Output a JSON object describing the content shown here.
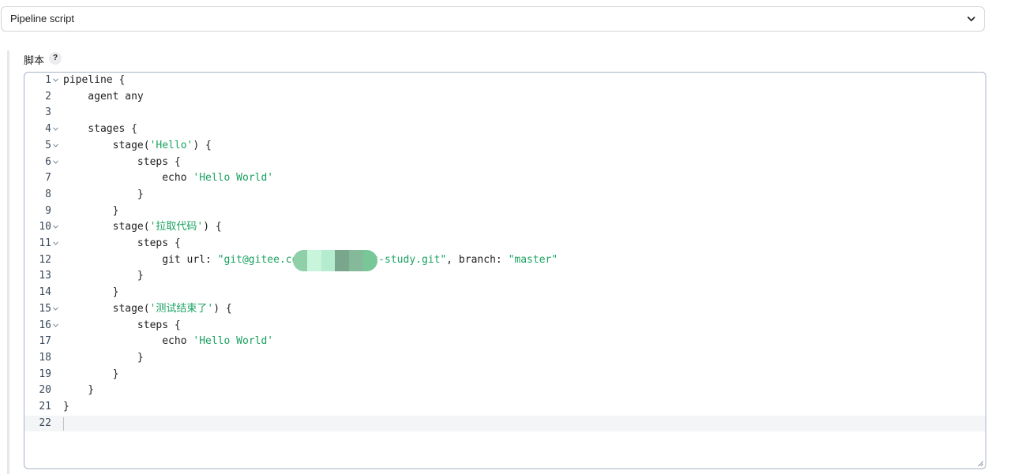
{
  "definition_select": {
    "value": "Pipeline script",
    "icon": "chevron-down-icon"
  },
  "script_field": {
    "label": "脚本",
    "help": "?"
  },
  "editor": {
    "colors": {
      "string": "#1aa260",
      "gutter": "#3b4a5c",
      "border": "#a6b4c8"
    },
    "lines": [
      {
        "num": "1",
        "fold": true,
        "parts": [
          {
            "t": "pipeline {",
            "s": false
          }
        ]
      },
      {
        "num": "2",
        "fold": false,
        "parts": [
          {
            "t": "    agent any",
            "s": false
          }
        ]
      },
      {
        "num": "3",
        "fold": false,
        "parts": [
          {
            "t": "",
            "s": false
          }
        ]
      },
      {
        "num": "4",
        "fold": true,
        "parts": [
          {
            "t": "    stages {",
            "s": false
          }
        ]
      },
      {
        "num": "5",
        "fold": true,
        "parts": [
          {
            "t": "        stage(",
            "s": false
          },
          {
            "t": "'Hello'",
            "s": true
          },
          {
            "t": ") {",
            "s": false
          }
        ]
      },
      {
        "num": "6",
        "fold": true,
        "parts": [
          {
            "t": "            steps {",
            "s": false
          }
        ]
      },
      {
        "num": "7",
        "fold": false,
        "parts": [
          {
            "t": "                echo ",
            "s": false
          },
          {
            "t": "'Hello World'",
            "s": true
          }
        ]
      },
      {
        "num": "8",
        "fold": false,
        "parts": [
          {
            "t": "            }",
            "s": false
          }
        ]
      },
      {
        "num": "9",
        "fold": false,
        "parts": [
          {
            "t": "        }",
            "s": false
          }
        ]
      },
      {
        "num": "10",
        "fold": true,
        "parts": [
          {
            "t": "        stage(",
            "s": false
          },
          {
            "t": "'拉取代码'",
            "s": true
          },
          {
            "t": ") {",
            "s": false
          }
        ]
      },
      {
        "num": "11",
        "fold": true,
        "parts": [
          {
            "t": "            steps {",
            "s": false
          }
        ]
      },
      {
        "num": "12",
        "fold": false,
        "parts": [
          {
            "t": "                git url: ",
            "s": false
          },
          {
            "t": "\"git@gitee.com",
            "s": true
          },
          {
            "t": "        ",
            "s": false
          },
          {
            "t": "/git-study.git\"",
            "s": true
          },
          {
            "t": ", branch: ",
            "s": false
          },
          {
            "t": "\"master\"",
            "s": true
          }
        ]
      },
      {
        "num": "13",
        "fold": false,
        "parts": [
          {
            "t": "            }",
            "s": false
          }
        ]
      },
      {
        "num": "14",
        "fold": false,
        "parts": [
          {
            "t": "        }",
            "s": false
          }
        ]
      },
      {
        "num": "15",
        "fold": true,
        "parts": [
          {
            "t": "        stage(",
            "s": false
          },
          {
            "t": "'测试结束了'",
            "s": true
          },
          {
            "t": ") {",
            "s": false
          }
        ]
      },
      {
        "num": "16",
        "fold": true,
        "parts": [
          {
            "t": "            steps {",
            "s": false
          }
        ]
      },
      {
        "num": "17",
        "fold": false,
        "parts": [
          {
            "t": "                echo ",
            "s": false
          },
          {
            "t": "'Hello World'",
            "s": true
          }
        ]
      },
      {
        "num": "18",
        "fold": false,
        "parts": [
          {
            "t": "            }",
            "s": false
          }
        ]
      },
      {
        "num": "19",
        "fold": false,
        "parts": [
          {
            "t": "        }",
            "s": false
          }
        ]
      },
      {
        "num": "20",
        "fold": false,
        "parts": [
          {
            "t": "    }",
            "s": false
          }
        ]
      },
      {
        "num": "21",
        "fold": false,
        "parts": [
          {
            "t": "}",
            "s": false
          }
        ]
      },
      {
        "num": "22",
        "fold": false,
        "active": true,
        "parts": [
          {
            "t": "",
            "s": false
          }
        ]
      }
    ]
  }
}
